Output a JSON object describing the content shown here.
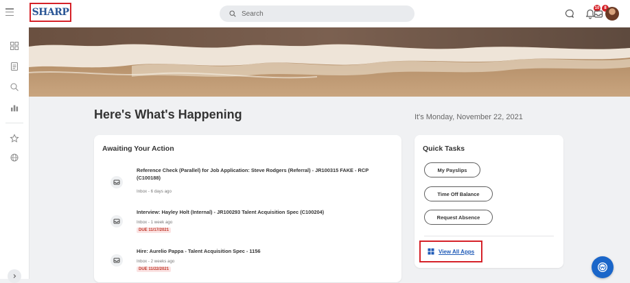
{
  "header": {
    "logo_text": "SHARP",
    "search_placeholder": "Search",
    "notifications_badge": "10",
    "inbox_badge": "8"
  },
  "main": {
    "title": "Here's What's Happening",
    "date": "It's Monday, November 22, 2021"
  },
  "awaiting": {
    "title": "Awaiting Your Action",
    "items": [
      {
        "title": "Reference Check (Parallel) for Job Application: Steve Rodgers (Referral) - JR100315 FAKE - RCP (C100188)",
        "meta": "Inbox - 6 days ago",
        "due": ""
      },
      {
        "title": "Interview: Hayley Holt (Internal) - JR100293 Talent Acquisition Spec (C100204)",
        "meta": "Inbox - 1 week ago",
        "due": "DUE 11/17/2021"
      },
      {
        "title": "Hire: Aurelio Pappa - Talent Acquisition Spec - 1156",
        "meta": "Inbox - 2 weeks ago",
        "due": "DUE 11/22/2021"
      }
    ]
  },
  "quick_tasks": {
    "title": "Quick Tasks",
    "buttons": [
      "My Payslips",
      "Time Off Balance",
      "Request Absence"
    ],
    "view_all": "View All Apps"
  },
  "colors": {
    "highlight": "#d52027",
    "link": "#1e5ab7",
    "logo": "#2a5696",
    "assistant": "#1a66c9"
  }
}
